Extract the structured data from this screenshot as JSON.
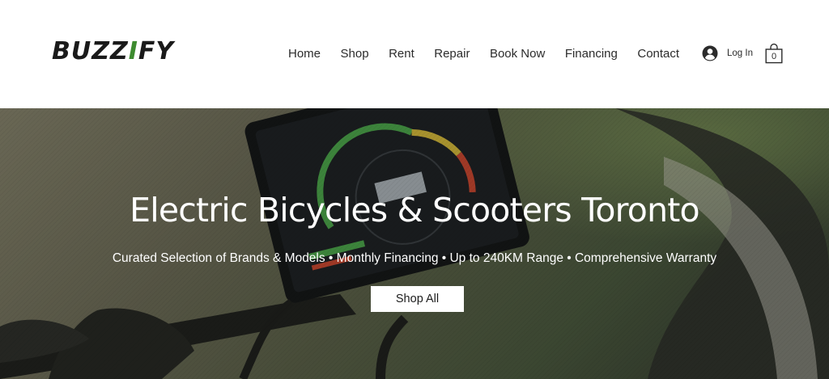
{
  "header": {
    "logo": {
      "text_main": "BUZZ",
      "text_accent": "I",
      "text_end": "FY"
    },
    "nav": {
      "items": [
        "Home",
        "Shop",
        "Rent",
        "Repair",
        "Book Now",
        "Financing",
        "Contact"
      ]
    },
    "login_label": "Log In",
    "cart_count": "0",
    "icons": {
      "login": "user-avatar-icon",
      "cart": "shopping-bag-icon"
    }
  },
  "hero": {
    "title": "Electric Bicycles & Scooters Toronto",
    "subtitle": "Curated Selection of Brands & Models • Monthly Financing • Up to 240KM Range • Comprehensive Warranty",
    "cta_label": "Shop All",
    "background": "e-bike-handlebar-display-photo"
  },
  "colors": {
    "logo_accent": "#3d8b2f",
    "text_dark": "#2b2b2b",
    "hero_text": "#ffffff"
  }
}
